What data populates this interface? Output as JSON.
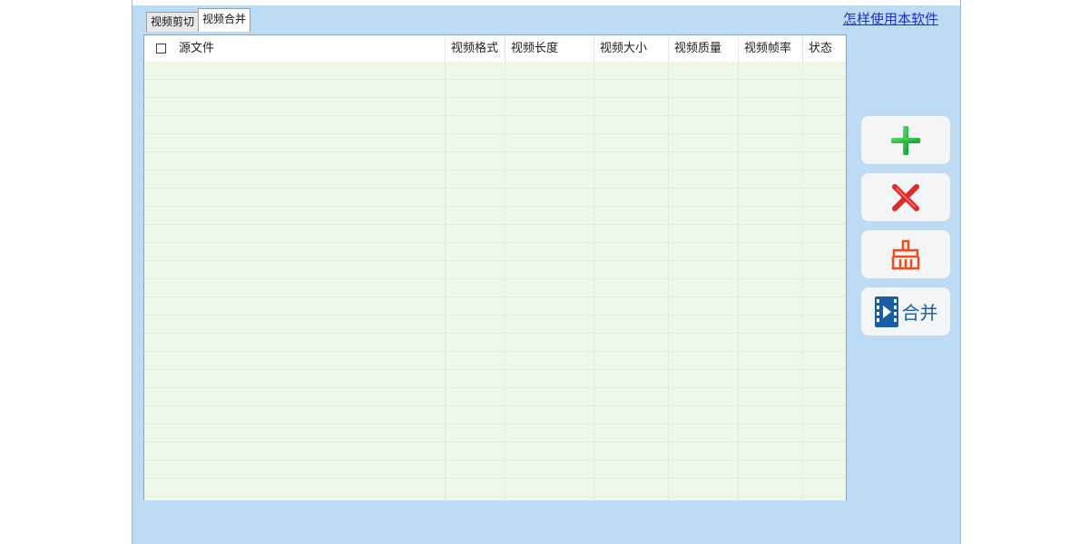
{
  "tabs": [
    {
      "label": "视频剪切",
      "active": false
    },
    {
      "label": "视频合并",
      "active": true
    }
  ],
  "help_link": "怎样使用本软件",
  "table": {
    "columns": [
      "源文件",
      "视频格式",
      "视频长度",
      "视频大小",
      "视频质量",
      "视频帧率",
      "状态"
    ],
    "rows": []
  },
  "actions": [
    {
      "icon": "add-icon"
    },
    {
      "icon": "delete-icon"
    },
    {
      "icon": "clear-icon"
    },
    {
      "icon": "film-merge-icon",
      "label": "合并"
    }
  ],
  "colors": {
    "window_bg": "#bcdcf6",
    "list_bg": "#eef8e6",
    "add_green": "#1fb73a",
    "delete_red": "#e02a2a",
    "clear_red": "#ef4a18",
    "merge_blue": "#1a5da5",
    "link_blue": "#1a2fd1"
  }
}
